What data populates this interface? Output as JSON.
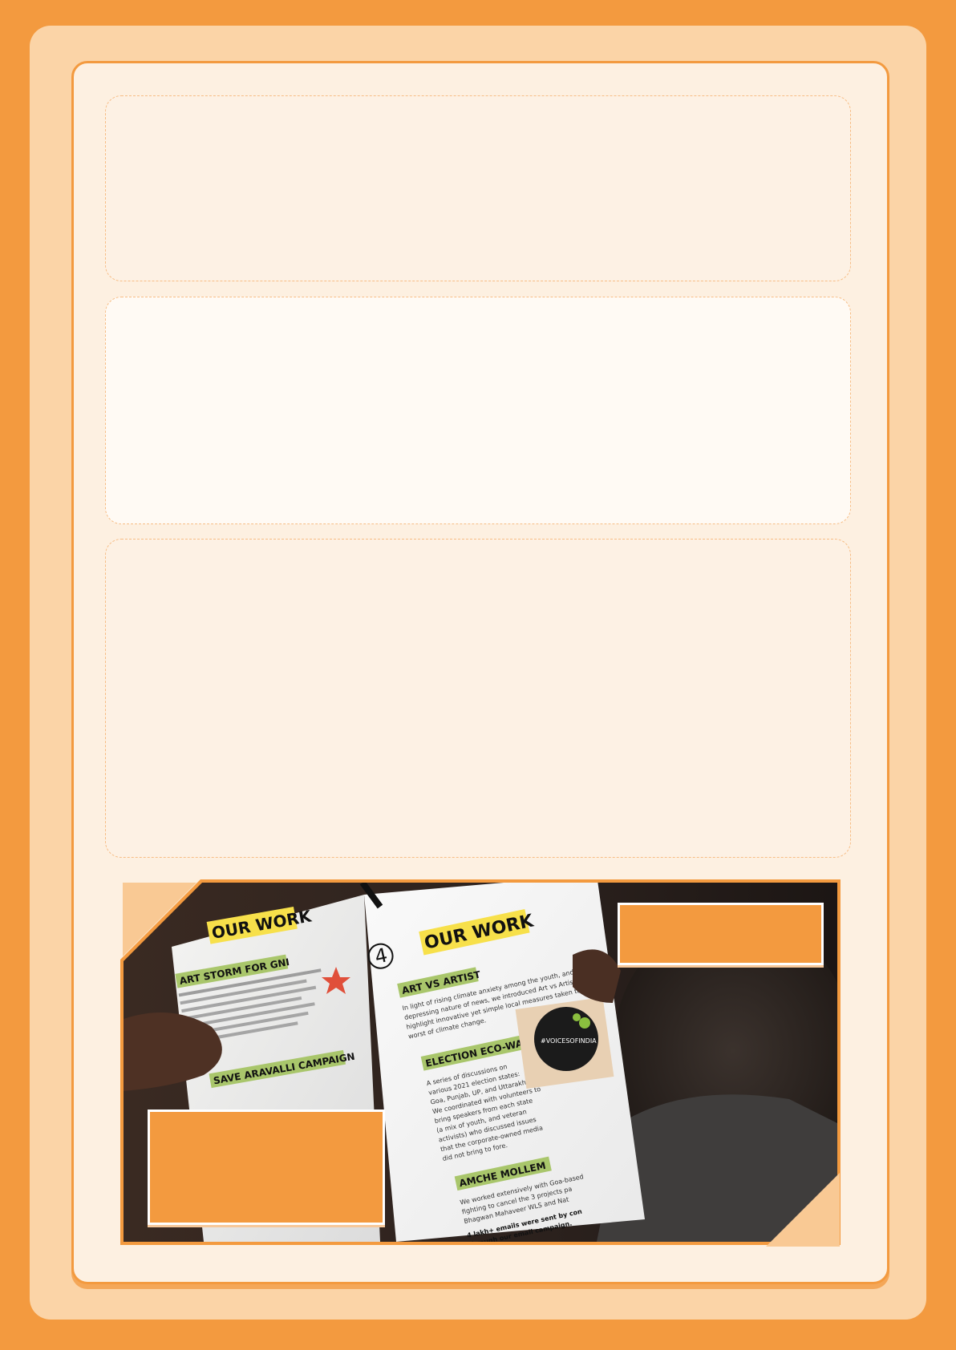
{
  "theme": {
    "background": "#f39a3f",
    "panel": "#fbd4a7",
    "card": "#fdf1e4",
    "accent": "#f39a3f"
  },
  "photo": {
    "left_page": {
      "heading": "OUR WORK",
      "section_1": "ART STORM FOR GNI",
      "section_2": "SAVE ARAVALLI CAMPAIGN"
    },
    "right_page": {
      "page_number": "4",
      "heading": "OUR WORK",
      "section_1": "ART VS ARTIST",
      "section_1_text": [
        "In light of rising climate anxiety among the youth, and the general",
        "depressing nature of news, we introduced Art vs Artist stories to",
        "highlight innovative yet simple local measures taken to tackle the",
        "worst of climate change."
      ],
      "section_2": "ELECTION ECO-WATCH",
      "section_2_text": [
        "A series of discussions on",
        "various 2021 election states:",
        "Goa, Punjab, UP, and Uttarakhand.",
        "We coordinated with volunteers to",
        "bring speakers from each state",
        "(a mix of youth, and veteran",
        "activists) who discussed issues",
        "that the corporate-owned media",
        "did not bring to fore."
      ],
      "section_3": "AMCHE MOLLEM",
      "section_3_text": [
        "We worked extensively with Goa-based",
        "fighting to cancel the 3 projects pa",
        "Bhagwan Mahaveer WLS and Nat"
      ],
      "callout": [
        "4 lakh+ emails were sent by con",
        "through our email campaign."
      ],
      "badge": "#VOICESOFINDIA"
    }
  }
}
